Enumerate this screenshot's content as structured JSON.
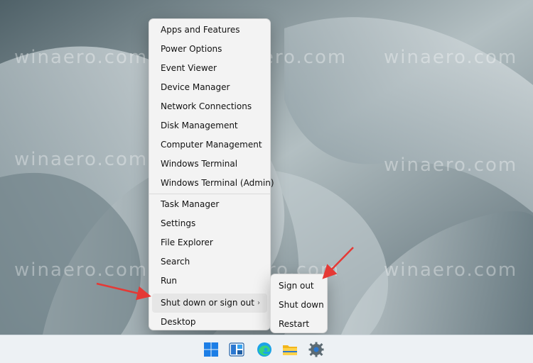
{
  "watermark": {
    "text": "winaero.com"
  },
  "context_menu": {
    "groups": [
      [
        {
          "label": "Apps and Features"
        },
        {
          "label": "Power Options"
        },
        {
          "label": "Event Viewer"
        },
        {
          "label": "Device Manager"
        },
        {
          "label": "Network Connections"
        },
        {
          "label": "Disk Management"
        },
        {
          "label": "Computer Management"
        },
        {
          "label": "Windows Terminal"
        },
        {
          "label": "Windows Terminal (Admin)"
        }
      ],
      [
        {
          "label": "Task Manager"
        },
        {
          "label": "Settings"
        },
        {
          "label": "File Explorer"
        },
        {
          "label": "Search"
        },
        {
          "label": "Run"
        },
        {
          "label": "Shut down or sign out"
        },
        {
          "label": "Desktop"
        }
      ]
    ],
    "submenu_chevron": "›"
  },
  "submenu": {
    "items": [
      {
        "label": "Sign out"
      },
      {
        "label": "Shut down"
      },
      {
        "label": "Restart"
      }
    ]
  },
  "taskbar": {
    "icons": [
      {
        "name": "windows-start-icon"
      },
      {
        "name": "widgets-icon"
      },
      {
        "name": "edge-icon"
      },
      {
        "name": "file-explorer-icon"
      },
      {
        "name": "settings-gear-icon"
      }
    ]
  },
  "colors": {
    "menu_bg": "#f3f3f3",
    "highlight": "#e6e6e6",
    "taskbar_bg": "#edf1f4",
    "annotation_arrow": "#e53935",
    "windows_blue": "#1c7ee6"
  }
}
